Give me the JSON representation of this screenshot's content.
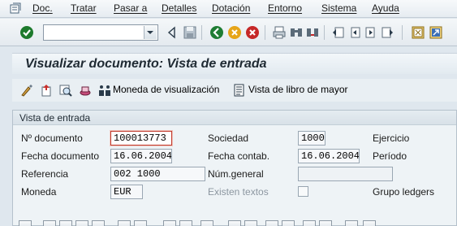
{
  "menu": {
    "items": [
      "Doc.",
      "Tratar",
      "Pasar a",
      "Detalles",
      "Dotación",
      "Entorno",
      "Sistema",
      "Ayuda"
    ]
  },
  "toolbar": {
    "command_field_value": ""
  },
  "title": "Visualizar documento: Vista de entrada",
  "app_toolbar": {
    "currency_label": "Moneda de visualización",
    "ledger_label": "Vista de libro de mayor"
  },
  "group": {
    "title": "Vista de entrada",
    "fields": {
      "doc_number_label": "Nº documento",
      "doc_number_value": "100013773",
      "doc_date_label": "Fecha documento",
      "doc_date_value": "16.06.2004",
      "reference_label": "Referencia",
      "reference_value": "002 1000",
      "currency_label": "Moneda",
      "currency_value": "EUR",
      "company_label": "Sociedad",
      "company_value": "1000",
      "posting_date_label": "Fecha contab.",
      "posting_date_value": "16.06.2004",
      "general_num_label": "Núm.general",
      "general_num_value": "",
      "texts_exist_label": "Existen textos",
      "fiscal_year_label": "Ejercicio",
      "period_label": "Período",
      "ledger_group_label": "Grupo ledgers"
    }
  }
}
